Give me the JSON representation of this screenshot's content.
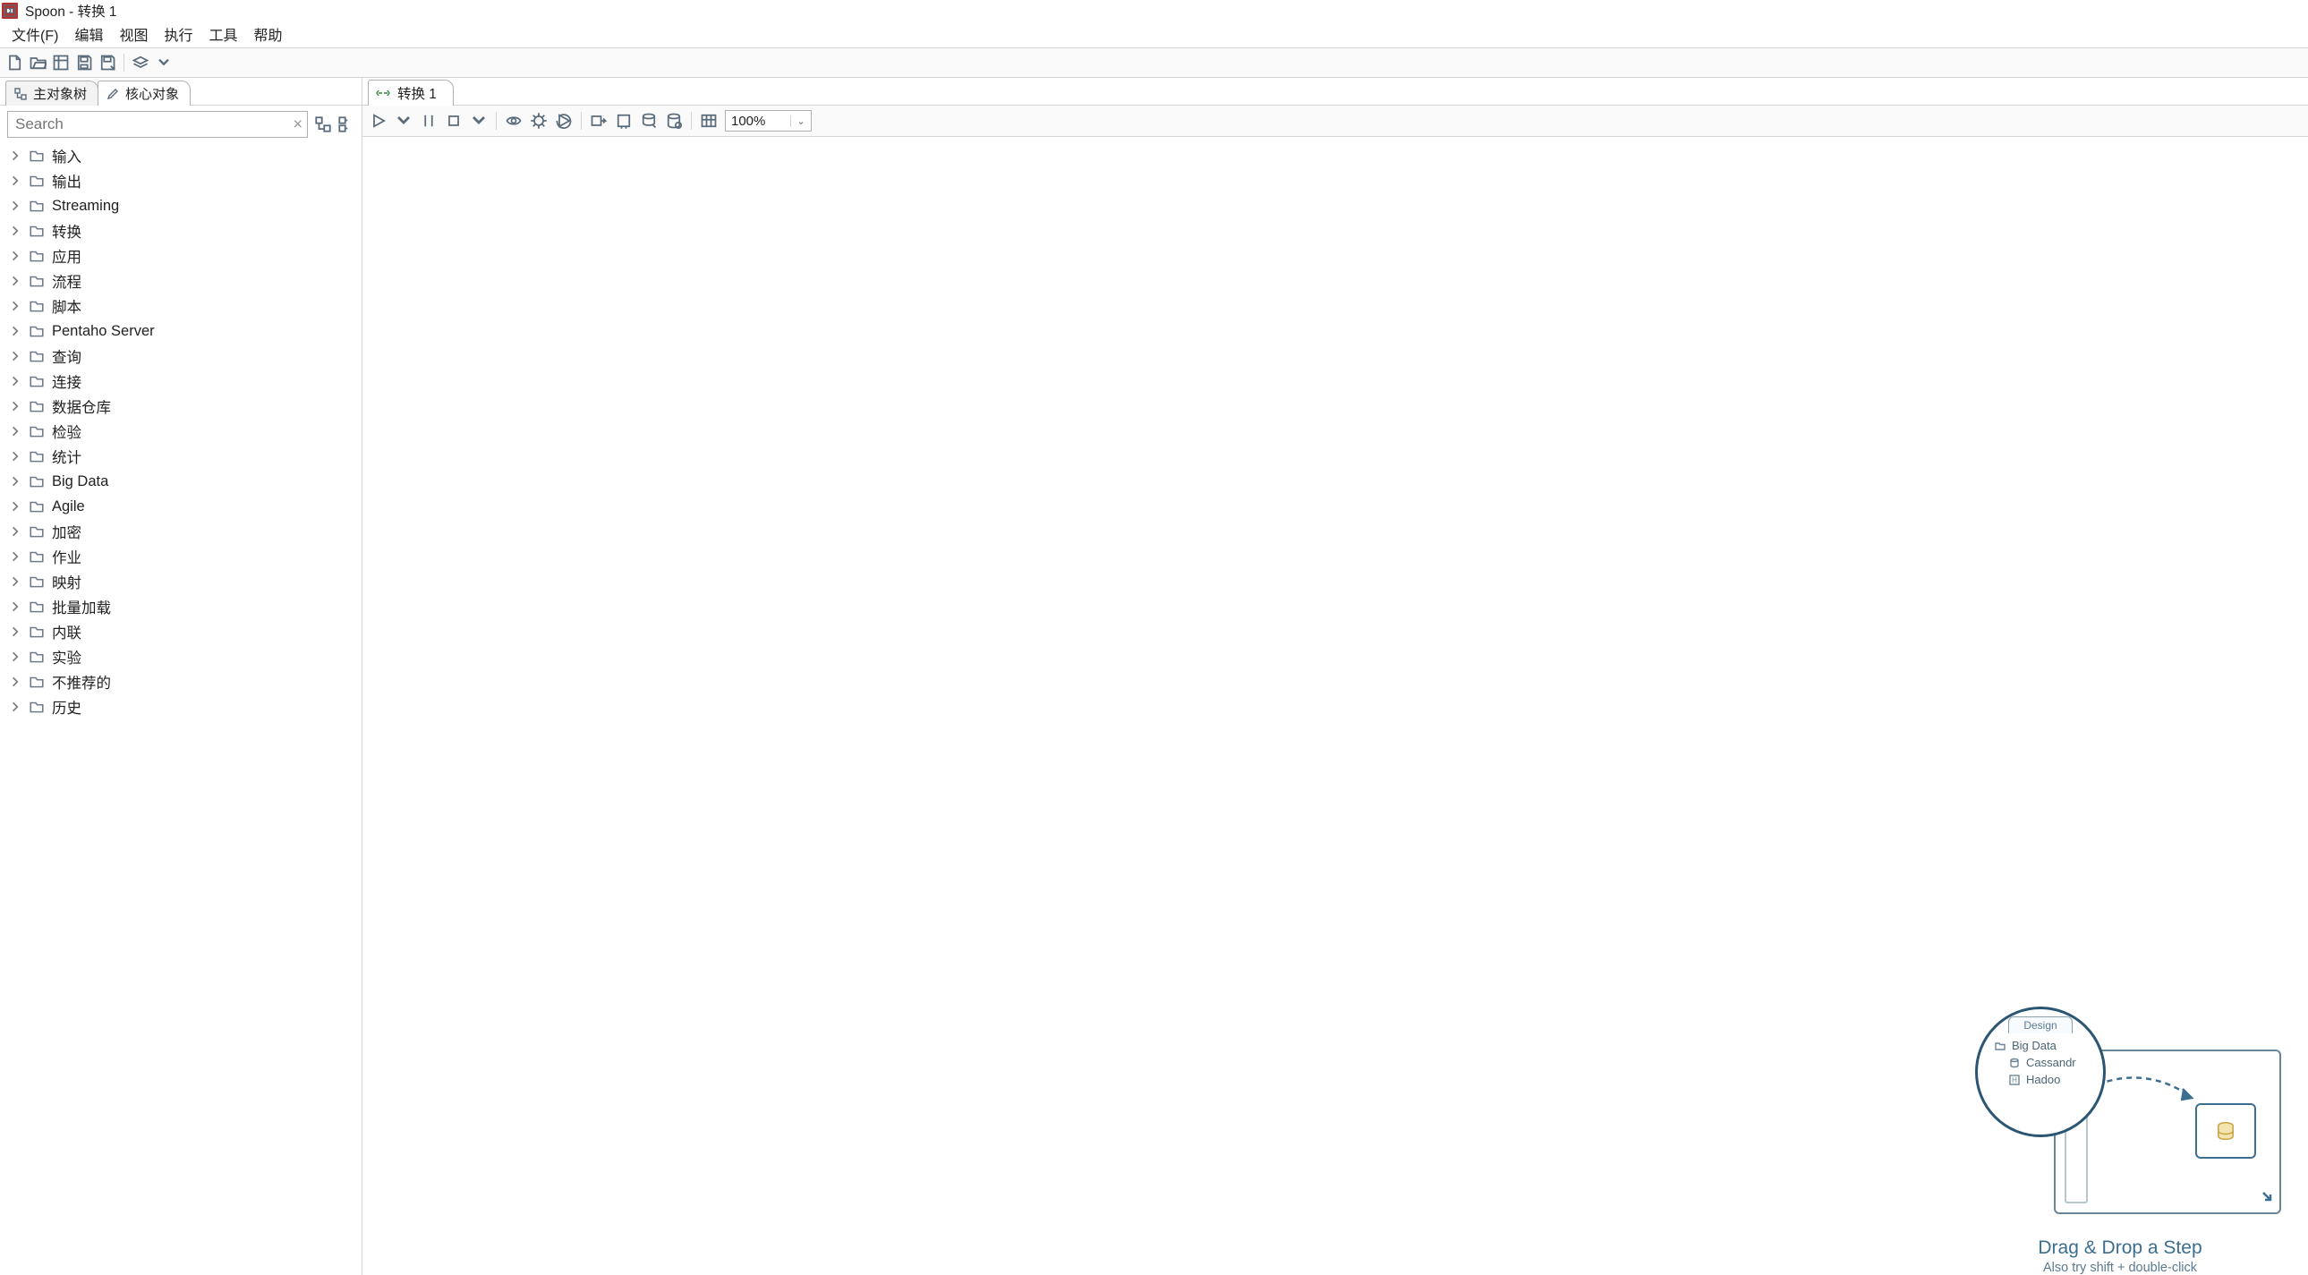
{
  "window": {
    "title": "Spoon - 转换 1"
  },
  "menu": {
    "file": "文件(F)",
    "edit": "编辑",
    "view": "视图",
    "run": "执行",
    "tools": "工具",
    "help": "帮助"
  },
  "leftTabs": {
    "mainTree": "主对象树",
    "core": "核心对象"
  },
  "search": {
    "placeholder": "Search"
  },
  "tree": {
    "items": [
      {
        "label": "输入"
      },
      {
        "label": "输出"
      },
      {
        "label": "Streaming"
      },
      {
        "label": "转换"
      },
      {
        "label": "应用"
      },
      {
        "label": "流程"
      },
      {
        "label": "脚本"
      },
      {
        "label": "Pentaho Server"
      },
      {
        "label": "查询"
      },
      {
        "label": "连接"
      },
      {
        "label": "数据仓库"
      },
      {
        "label": "检验"
      },
      {
        "label": "统计"
      },
      {
        "label": "Big Data"
      },
      {
        "label": "Agile"
      },
      {
        "label": "加密"
      },
      {
        "label": "作业"
      },
      {
        "label": "映射"
      },
      {
        "label": "批量加载"
      },
      {
        "label": "内联"
      },
      {
        "label": "实验"
      },
      {
        "label": "不推荐的"
      },
      {
        "label": "历史"
      }
    ]
  },
  "editor": {
    "tab": "转换 1",
    "zoom": "100%"
  },
  "hint": {
    "designTab": "Design",
    "bigData": "Big Data",
    "cassandra": "Cassandr",
    "hadoop": "Hadoo",
    "title": "Drag & Drop a Step",
    "sub": "Also try shift + double-click"
  }
}
